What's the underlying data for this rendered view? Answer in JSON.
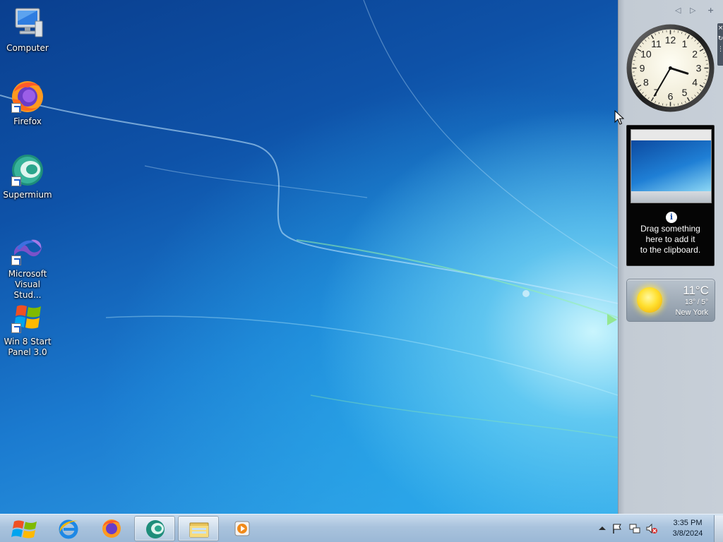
{
  "desktop": {
    "icons": [
      {
        "label": "Computer",
        "icon": "computer-icon"
      },
      {
        "label": "Firefox",
        "icon": "firefox-icon"
      },
      {
        "label": "Supermium",
        "icon": "supermium-icon"
      },
      {
        "label": "Microsoft Visual Stud...",
        "icon": "visual-studio-icon"
      },
      {
        "label": "Win 8 Start Panel 3.0",
        "icon": "windows-flag-icon"
      }
    ]
  },
  "sidebar": {
    "controls": {
      "prev": "◁",
      "next": "▷",
      "add": "+"
    },
    "gadget_toolbar": {
      "close": "×",
      "options": "↻",
      "drag": "⋮"
    },
    "clock": {
      "numerals": [
        "12",
        "1",
        "2",
        "3",
        "4",
        "5",
        "6",
        "7",
        "8",
        "9",
        "10",
        "11"
      ],
      "hour": 3,
      "minute": 35
    },
    "clipboard": {
      "info_symbol": "i",
      "lines": [
        "Drag something",
        "here to add it",
        "to the clipboard."
      ]
    },
    "weather": {
      "temperature": "11°C",
      "range": "13° / 5°",
      "city": "New York",
      "condition_icon": "sun-icon"
    }
  },
  "taskbar": {
    "start_icon": "windows-start-orb-icon",
    "pinned": [
      {
        "name": "internet-explorer",
        "icon": "internet-explorer-icon",
        "active": false
      },
      {
        "name": "firefox",
        "icon": "firefox-icon",
        "active": false
      },
      {
        "name": "supermium",
        "icon": "supermium-icon",
        "active": true
      },
      {
        "name": "file-explorer",
        "icon": "folder-icon",
        "active": true
      },
      {
        "name": "media-player",
        "icon": "media-player-icon",
        "active": false
      }
    ],
    "tray": {
      "time": "3:35 PM",
      "date": "3/8/2024",
      "icons": [
        "show-hidden-icons-arrow",
        "action-center-flag-icon",
        "network-icon",
        "volume-muted-icon"
      ]
    }
  },
  "colors": {
    "taskbar": "#a9c3dd",
    "sidebar": "#c3cbd4",
    "clipboard_bg": "#050505"
  }
}
